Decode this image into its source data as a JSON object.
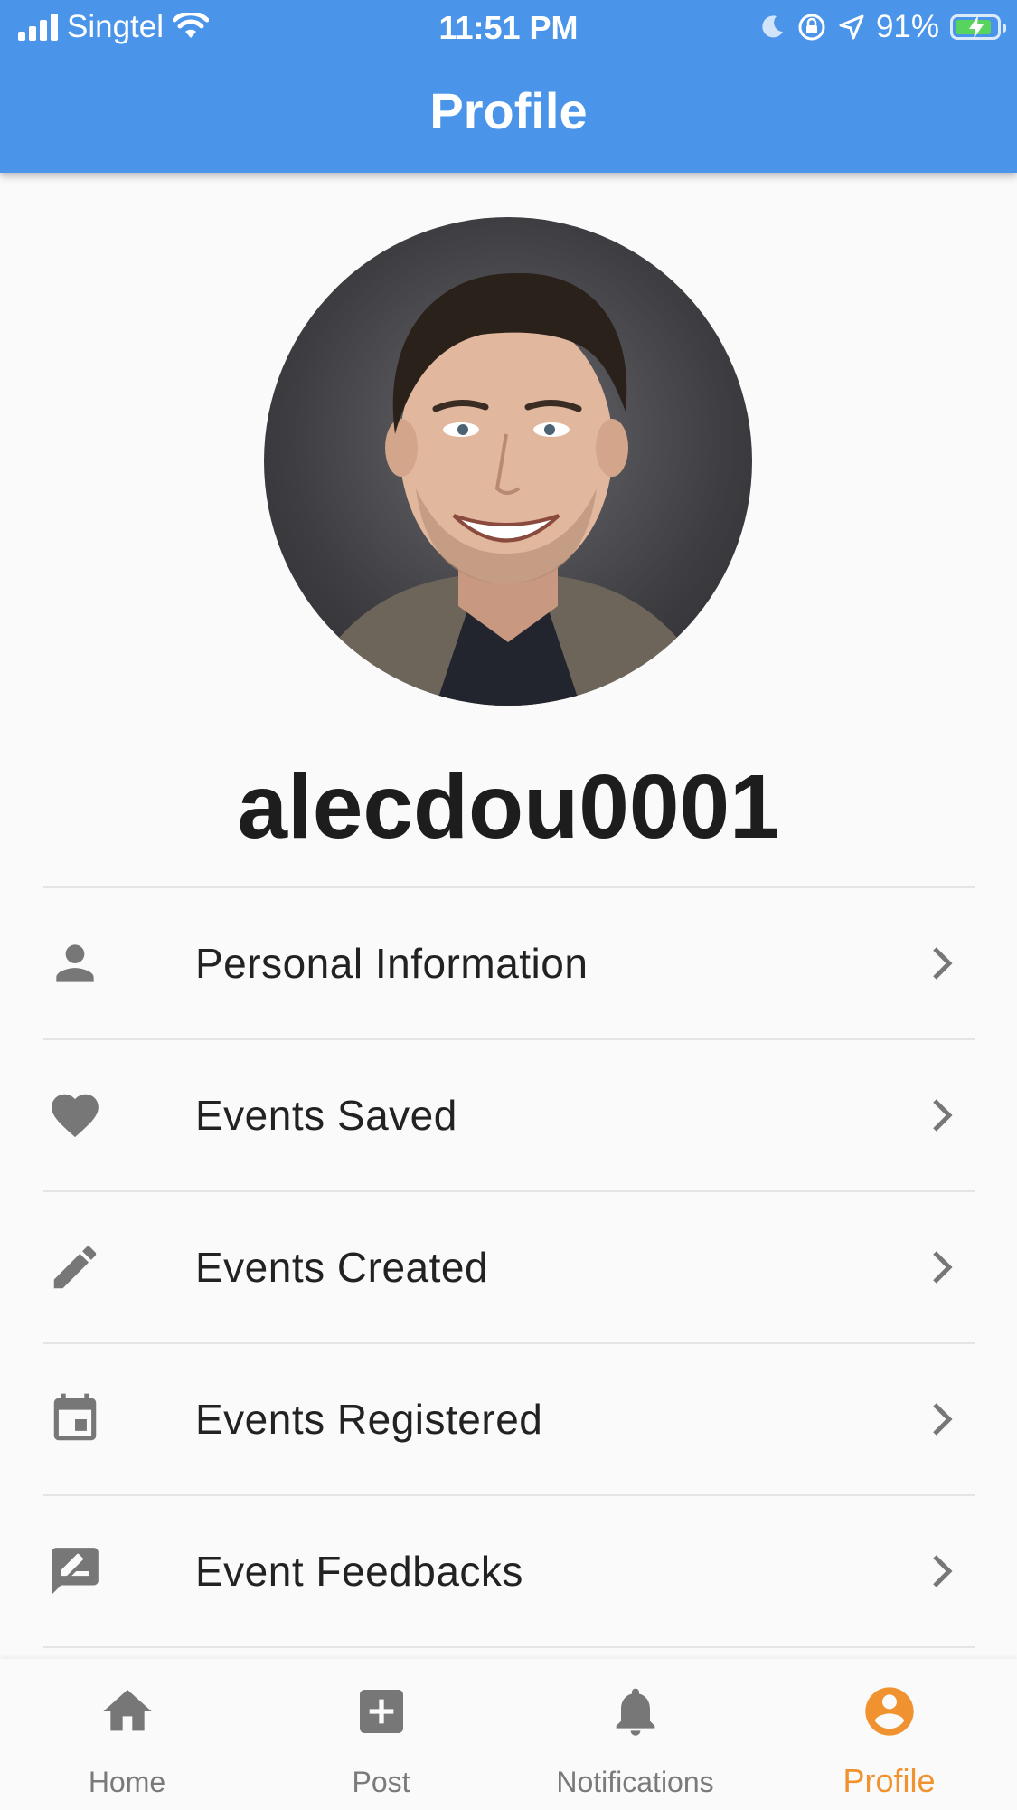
{
  "status_bar": {
    "carrier": "Singtel",
    "time": "11:51 PM",
    "battery_percent": "91%"
  },
  "header": {
    "title": "Profile"
  },
  "profile": {
    "username": "alecdou0001"
  },
  "menu": {
    "items": [
      {
        "label": "Personal Information",
        "icon": "person-icon"
      },
      {
        "label": "Events Saved",
        "icon": "heart-icon"
      },
      {
        "label": "Events Created",
        "icon": "pencil-icon"
      },
      {
        "label": "Events Registered",
        "icon": "calendar-icon"
      },
      {
        "label": "Event Feedbacks",
        "icon": "feedback-icon"
      }
    ]
  },
  "tabbar": {
    "tabs": [
      {
        "label": "Home",
        "icon": "home-icon"
      },
      {
        "label": "Post",
        "icon": "add-box-icon"
      },
      {
        "label": "Notifications",
        "icon": "bell-icon"
      },
      {
        "label": "Profile",
        "icon": "account-circle-icon",
        "active": true
      }
    ]
  },
  "colors": {
    "header": "#4a94ea",
    "accent": "#f0922f",
    "icon_gray": "#777777",
    "battery": "#58d35d"
  }
}
